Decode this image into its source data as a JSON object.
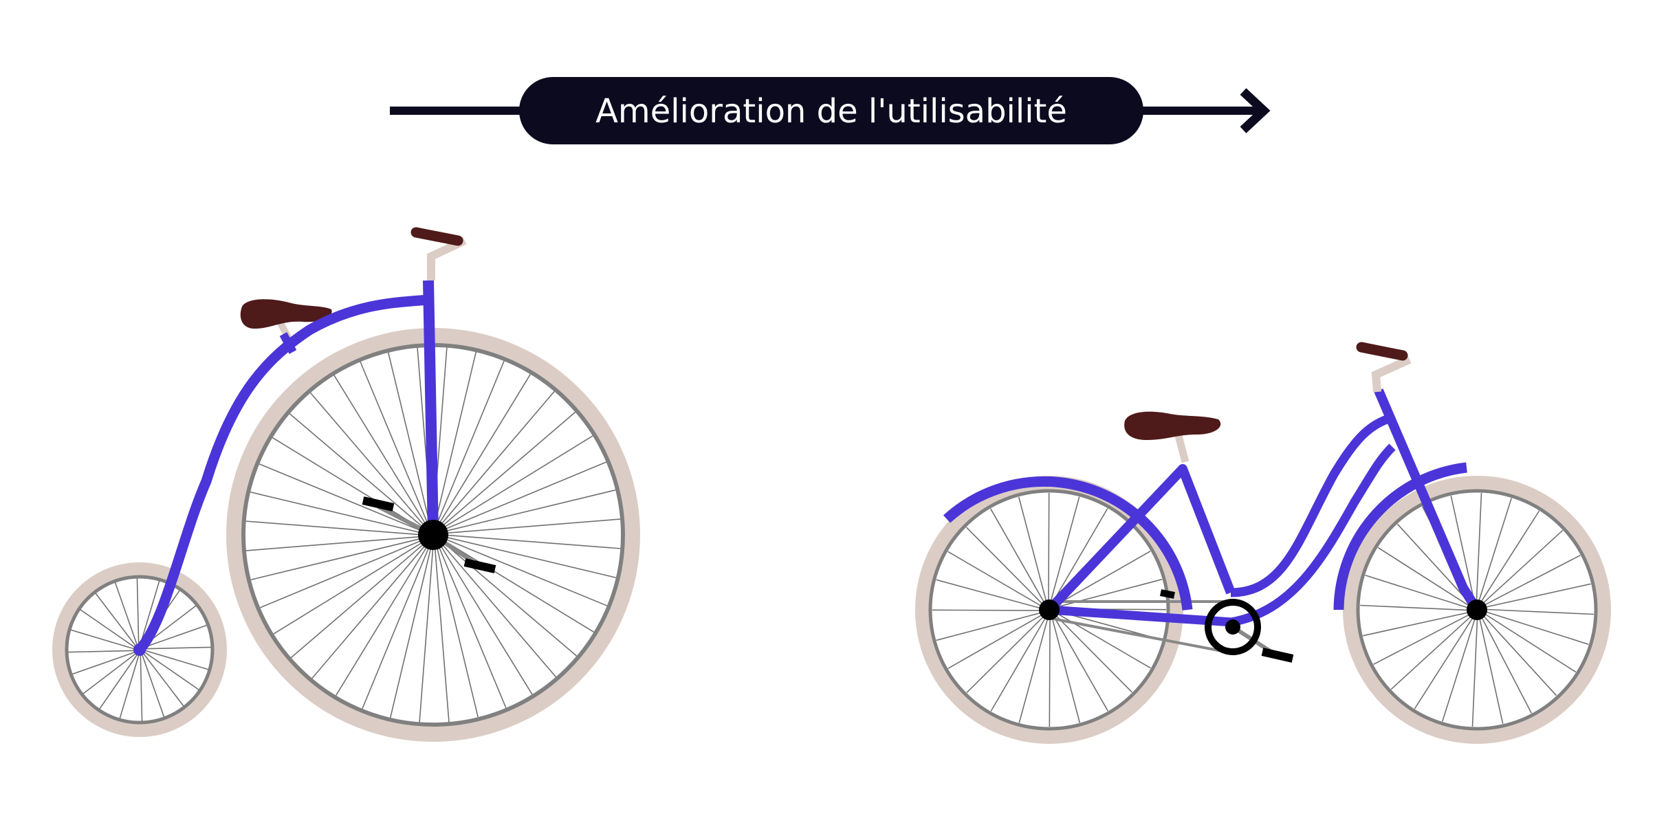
{
  "header": {
    "label": "Amélioration de l'utilisabilité",
    "arrow_icon": "arrow-right-icon"
  },
  "colors": {
    "frame": "#4b35d8",
    "tire": "#dbcdc5",
    "rim": "#808080",
    "spoke": "#707070",
    "saddle": "#4f1a1a",
    "seatpost": "#dbcdc5",
    "hub": "#000000",
    "pill_bg": "#0c0a1f"
  },
  "bikes": [
    {
      "name": "penny-farthing"
    },
    {
      "name": "modern-bicycle"
    }
  ]
}
